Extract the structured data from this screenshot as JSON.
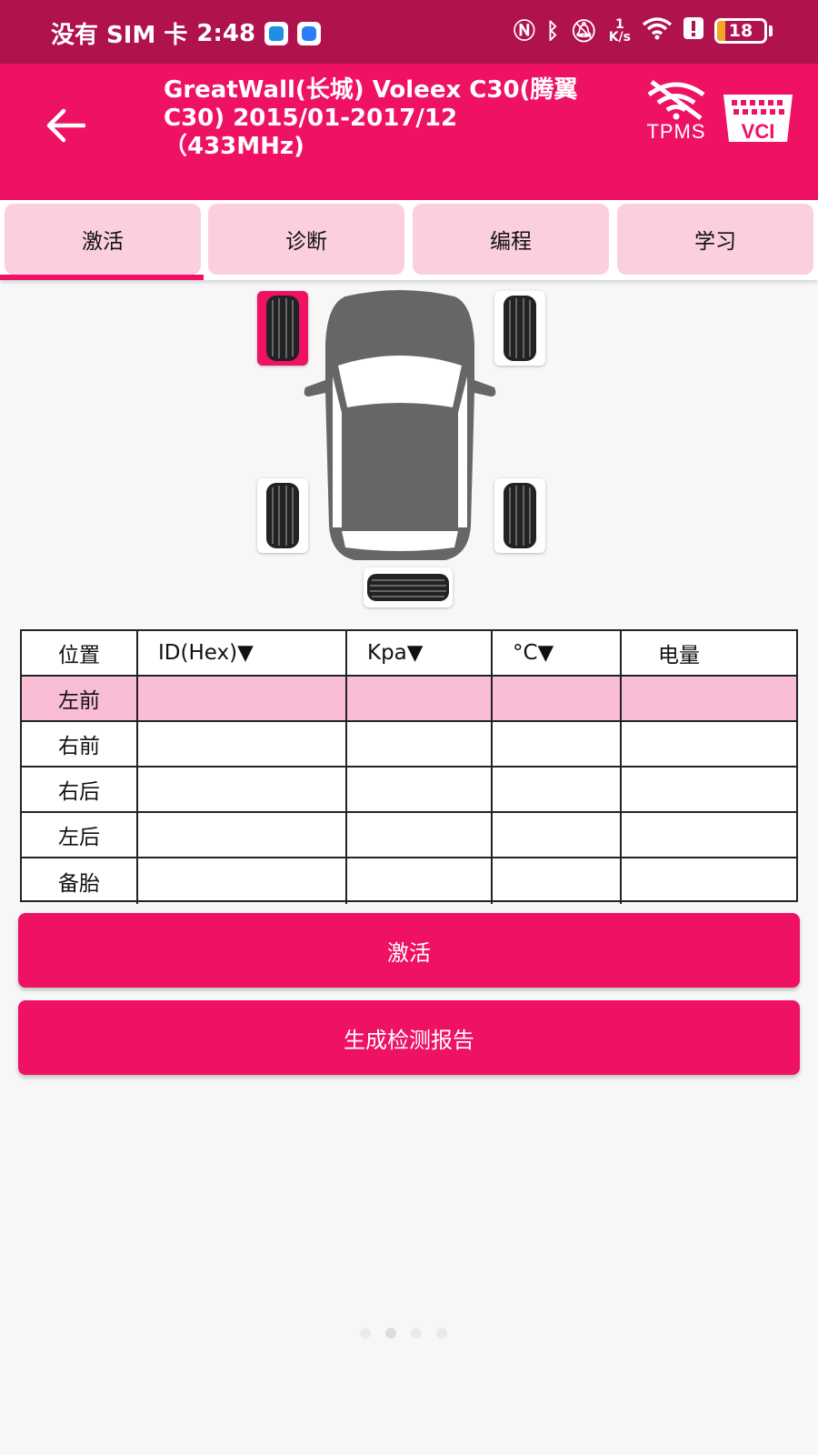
{
  "status_bar": {
    "carrier": "没有 SIM 卡",
    "time": "2:48",
    "net_speed_value": "1",
    "net_speed_unit": "K/s",
    "battery_level": "18",
    "icons": [
      "shield-app-icon",
      "message-app-icon",
      "nfc-icon",
      "bluetooth-icon",
      "bell-muted-icon",
      "wifi-icon",
      "alert-icon",
      "battery-icon"
    ]
  },
  "header": {
    "title": "GreatWall(长城) Voleex C30(腾翼C30) 2015/01-2017/12 （433MHz)",
    "tpms_label": "TPMS",
    "vci_label": "VCI"
  },
  "tabs": [
    {
      "label": "激活",
      "active": true
    },
    {
      "label": "诊断",
      "active": false
    },
    {
      "label": "编程",
      "active": false
    },
    {
      "label": "学习",
      "active": false
    }
  ],
  "colors": {
    "status_bar": "#b0124e",
    "accent": "#ee1164",
    "tab_bg": "#fbcfe0",
    "row_highlight": "#f9bdd6"
  },
  "table": {
    "headers": [
      "位置",
      "ID(Hex)▼",
      "Kpa▼",
      "°C▼",
      "电量"
    ],
    "rows": [
      {
        "position": "左前",
        "id": "",
        "kpa": "",
        "temp": "",
        "battery": "",
        "selected": true
      },
      {
        "position": "右前",
        "id": "",
        "kpa": "",
        "temp": "",
        "battery": "",
        "selected": false
      },
      {
        "position": "右后",
        "id": "",
        "kpa": "",
        "temp": "",
        "battery": "",
        "selected": false
      },
      {
        "position": "左后",
        "id": "",
        "kpa": "",
        "temp": "",
        "battery": "",
        "selected": false
      },
      {
        "position": "备胎",
        "id": "",
        "kpa": "",
        "temp": "",
        "battery": "",
        "selected": false
      }
    ]
  },
  "buttons": {
    "activate": "激活",
    "report": "生成检测报告"
  },
  "page_dots": {
    "count": 4,
    "current": 2
  }
}
